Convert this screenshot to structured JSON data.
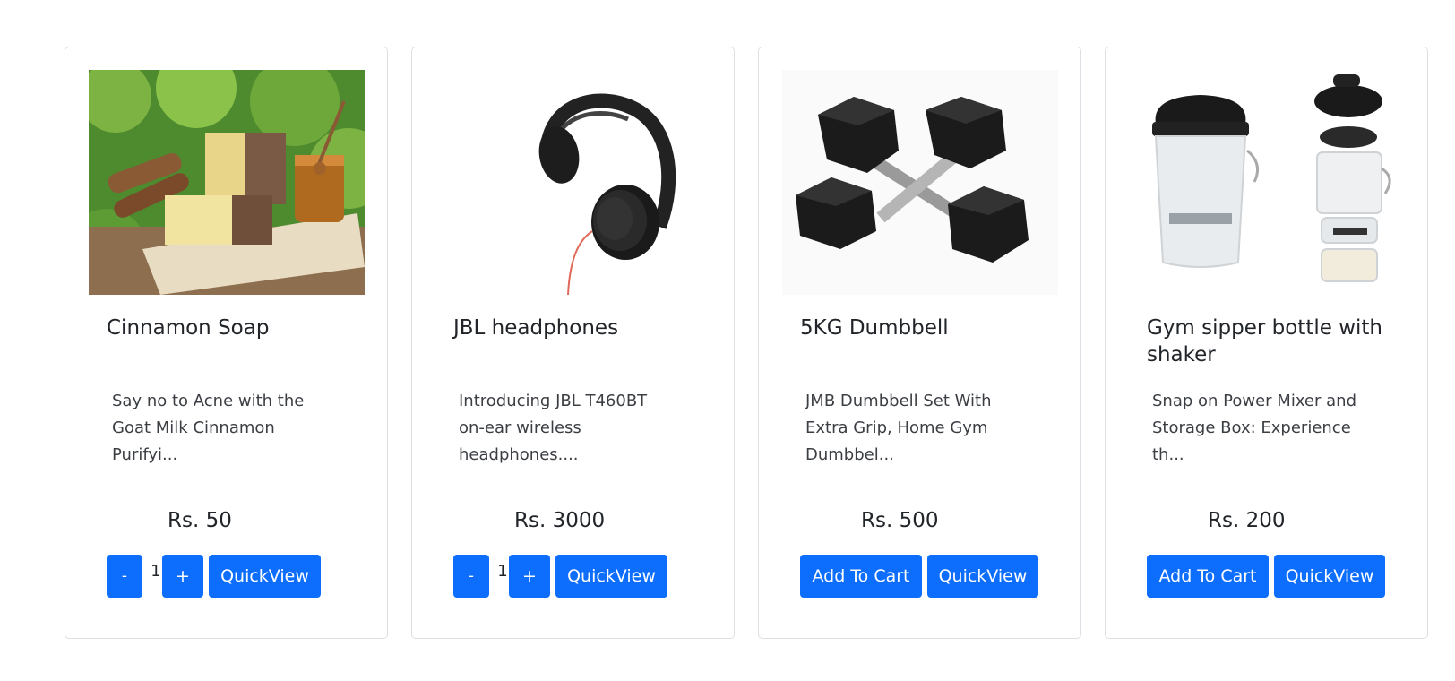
{
  "products": [
    {
      "title": "Cinnamon Soap",
      "description": "Say no to Acne with the Goat Milk Cinnamon Purifyi...",
      "price": "Rs. 50",
      "in_cart": true,
      "minus_label": "-",
      "quantity": "1",
      "plus_label": "+",
      "quickview_label": "QuickView"
    },
    {
      "title": "JBL headphones",
      "description": "Introducing JBL T460BT on-ear wireless headphones....",
      "price": "Rs. 3000",
      "in_cart": true,
      "minus_label": "-",
      "quantity": "1",
      "plus_label": "+",
      "quickview_label": "QuickView"
    },
    {
      "title": "5KG Dumbbell",
      "description": "JMB Dumbbell Set With Extra Grip, Home Gym Dumbbel...",
      "price": "Rs. 500",
      "in_cart": false,
      "add_label": "Add To Cart",
      "quickview_label": "QuickView"
    },
    {
      "title": "Gym sipper bottle with shaker",
      "description": "Snap on Power Mixer and Storage Box: Experience th...",
      "price": "Rs. 200",
      "in_cart": false,
      "add_label": "Add To Cart",
      "quickview_label": "QuickView"
    }
  ],
  "colors": {
    "primary": "#0d6efd",
    "card_border": "#dcdfe3",
    "text": "#212529"
  }
}
